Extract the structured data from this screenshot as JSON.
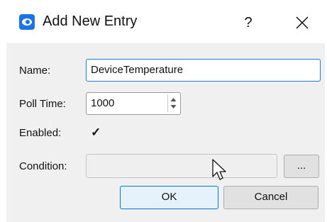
{
  "window": {
    "title": "Add New Entry",
    "help_label": "?",
    "close_icon": "close-icon",
    "app_icon": "app-eye-icon"
  },
  "form": {
    "name_label": "Name:",
    "name_value": "DeviceTemperature",
    "poll_time_label": "Poll Time:",
    "poll_time_value": "1000",
    "enabled_label": "Enabled:",
    "enabled_mark": "✓",
    "condition_label": "Condition:",
    "condition_value": "",
    "browse_label": "..."
  },
  "buttons": {
    "ok_label": "OK",
    "cancel_label": "Cancel"
  },
  "colors": {
    "focus_border": "#1e7bd8",
    "accent": "#0078d7"
  }
}
